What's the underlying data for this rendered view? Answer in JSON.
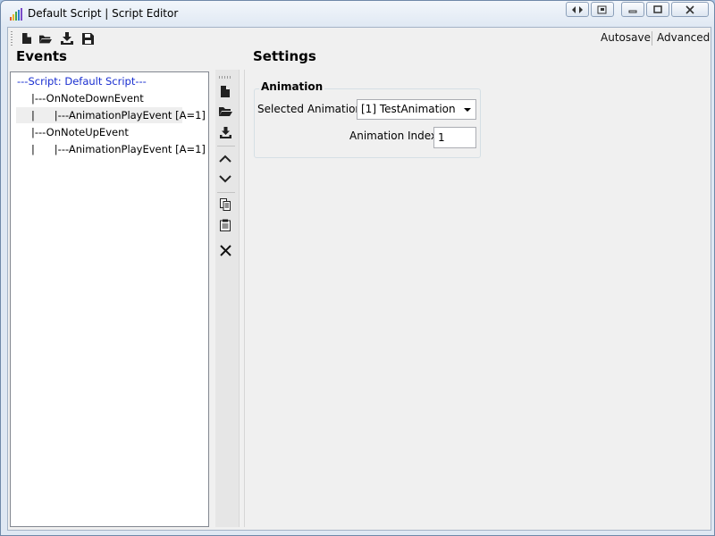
{
  "window": {
    "title": "Default Script | Script Editor",
    "caption_buttons": [
      "restore-left-icon",
      "popout-icon",
      "minimize-icon",
      "maximize-icon",
      "close-icon"
    ]
  },
  "toolbar": {
    "icons": [
      "new-file-icon",
      "open-folder-icon",
      "import-icon",
      "save-icon"
    ],
    "autosave_label": "Autosave",
    "advanced_label": "Advanced"
  },
  "events_panel": {
    "title": "Events",
    "tree": [
      {
        "text": "---Script: Default Script---",
        "kind": "root"
      },
      {
        "text": "|---OnNoteDownEvent",
        "kind": "event"
      },
      {
        "text": "|      |---AnimationPlayEvent [A=1]",
        "kind": "action",
        "selected": true
      },
      {
        "text": "|---OnNoteUpEvent",
        "kind": "event"
      },
      {
        "text": "|      |---AnimationPlayEvent [A=1]",
        "kind": "action"
      }
    ],
    "side_tools": [
      "new-icon",
      "open-icon",
      "import-icon",
      "move-up-icon",
      "move-down-icon",
      "copy-icon",
      "paste-icon",
      "delete-icon"
    ]
  },
  "settings_panel": {
    "title": "Settings",
    "group_title": "Animation",
    "selected_animation_label": "Selected Animation:",
    "selected_animation_value": "[1] TestAnimation",
    "animation_index_label": "Animation Index:",
    "animation_index_value": "1"
  },
  "colors": {
    "root_text": "#1a2fd0",
    "panel_bg": "#f0f0f0",
    "tree_bg": "#ffffff"
  }
}
